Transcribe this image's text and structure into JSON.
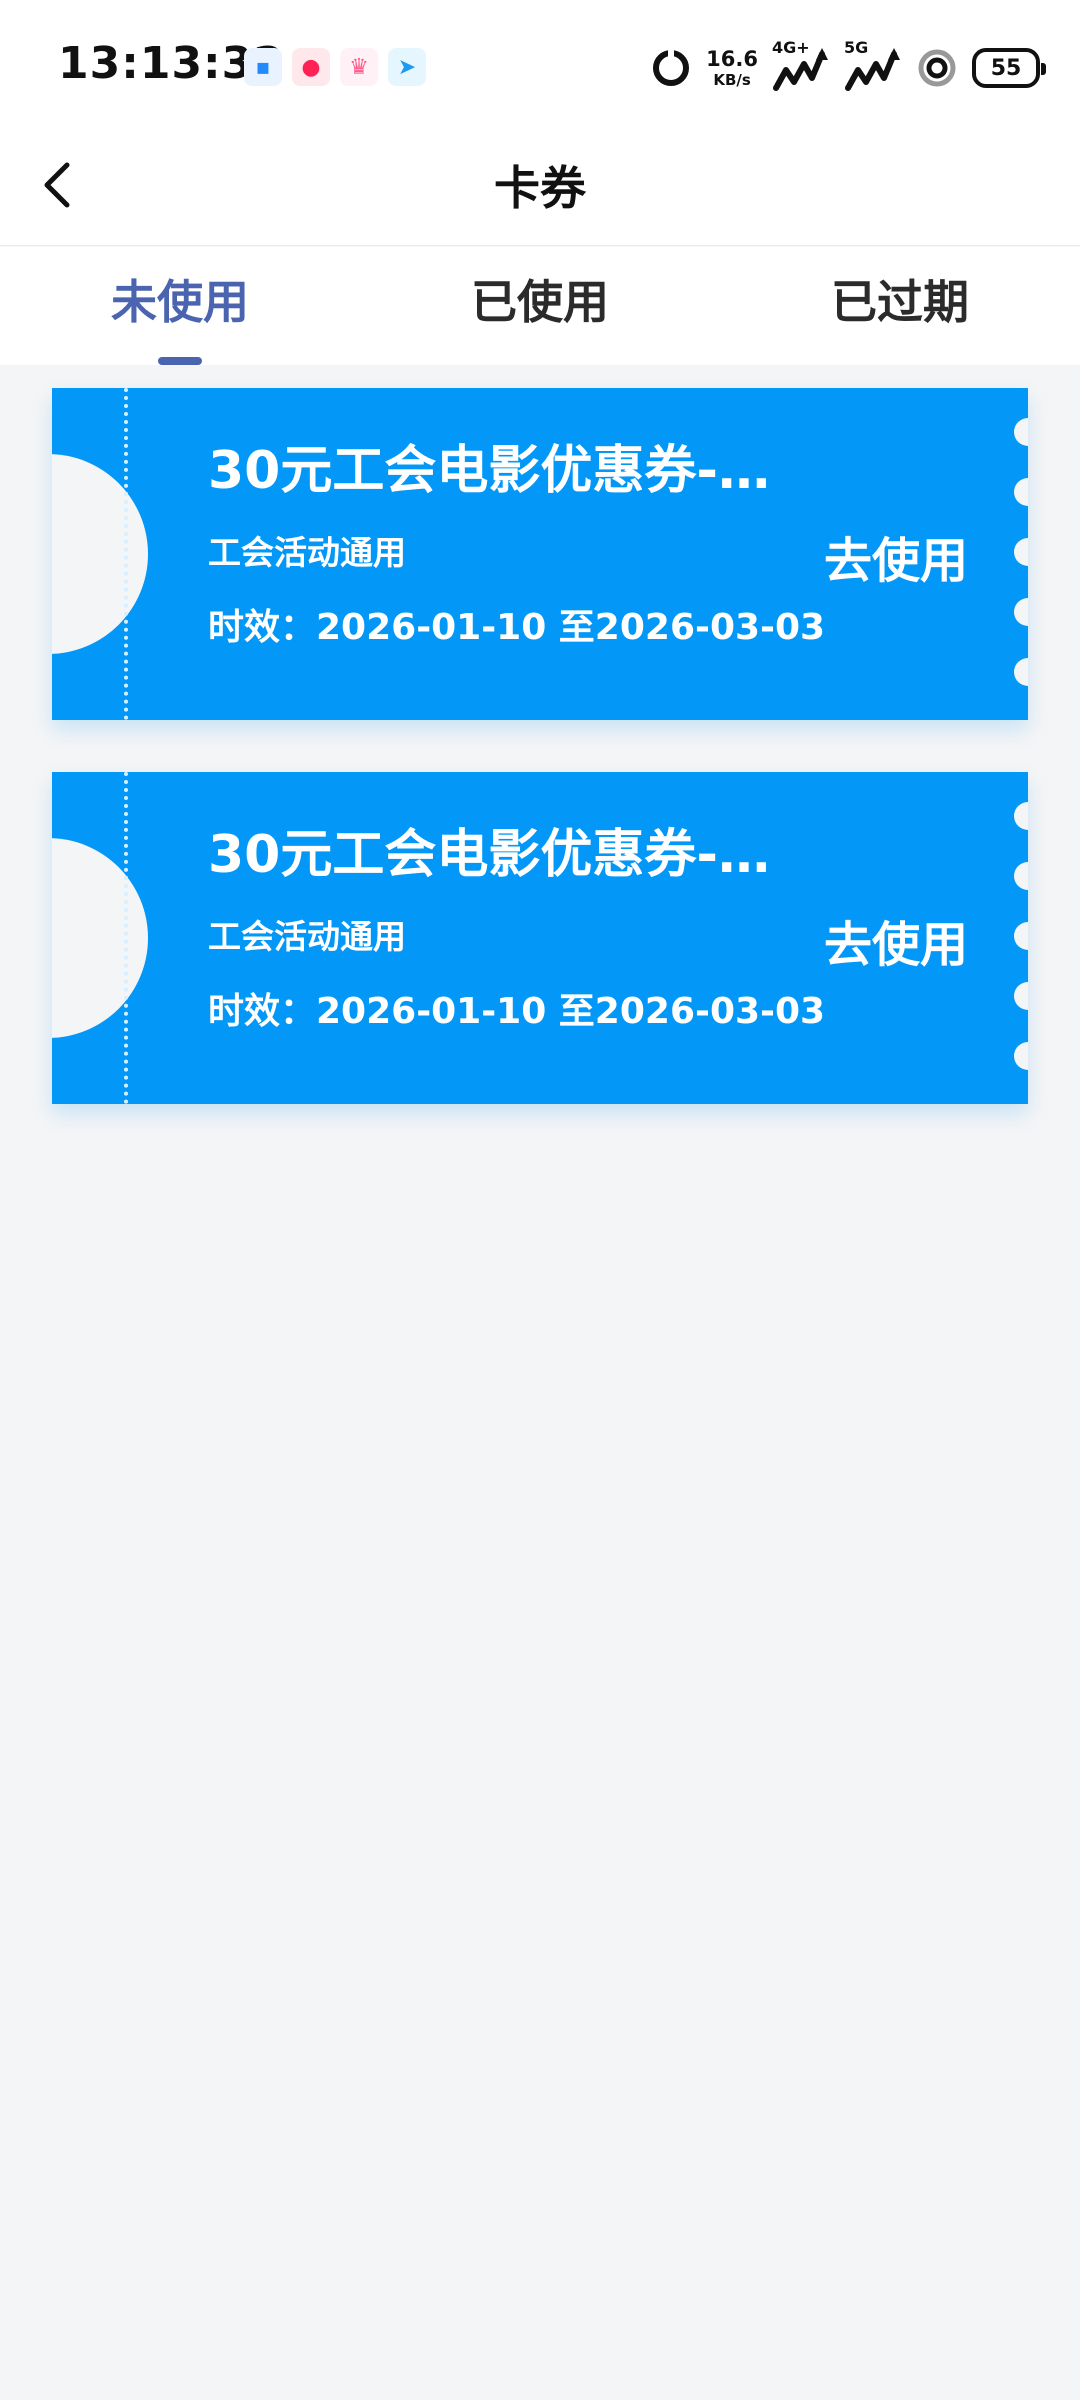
{
  "status_bar": {
    "time": "13:13:32",
    "net_speed_value": "16.6",
    "net_speed_unit": "KB/s",
    "sim1_label": "4G+",
    "sim2_label": "5G",
    "battery": "55"
  },
  "header": {
    "title": "卡券"
  },
  "tabs": [
    {
      "label": "未使用"
    },
    {
      "label": "已使用"
    },
    {
      "label": "已过期"
    }
  ],
  "coupons": [
    {
      "title": "30元工会电影优惠券-…",
      "scope": "工会活动通用",
      "validity": "时效：2026-01-10 至2026-03-03",
      "action": "去使用"
    },
    {
      "title": "30元工会电影优惠券-…",
      "scope": "工会活动通用",
      "validity": "时效：2026-01-10 至2026-03-03",
      "action": "去使用"
    }
  ],
  "colors": {
    "accent": "#4a64b0",
    "coupon_bg": "#0398f7",
    "page_bg": "#f4f5f6"
  }
}
